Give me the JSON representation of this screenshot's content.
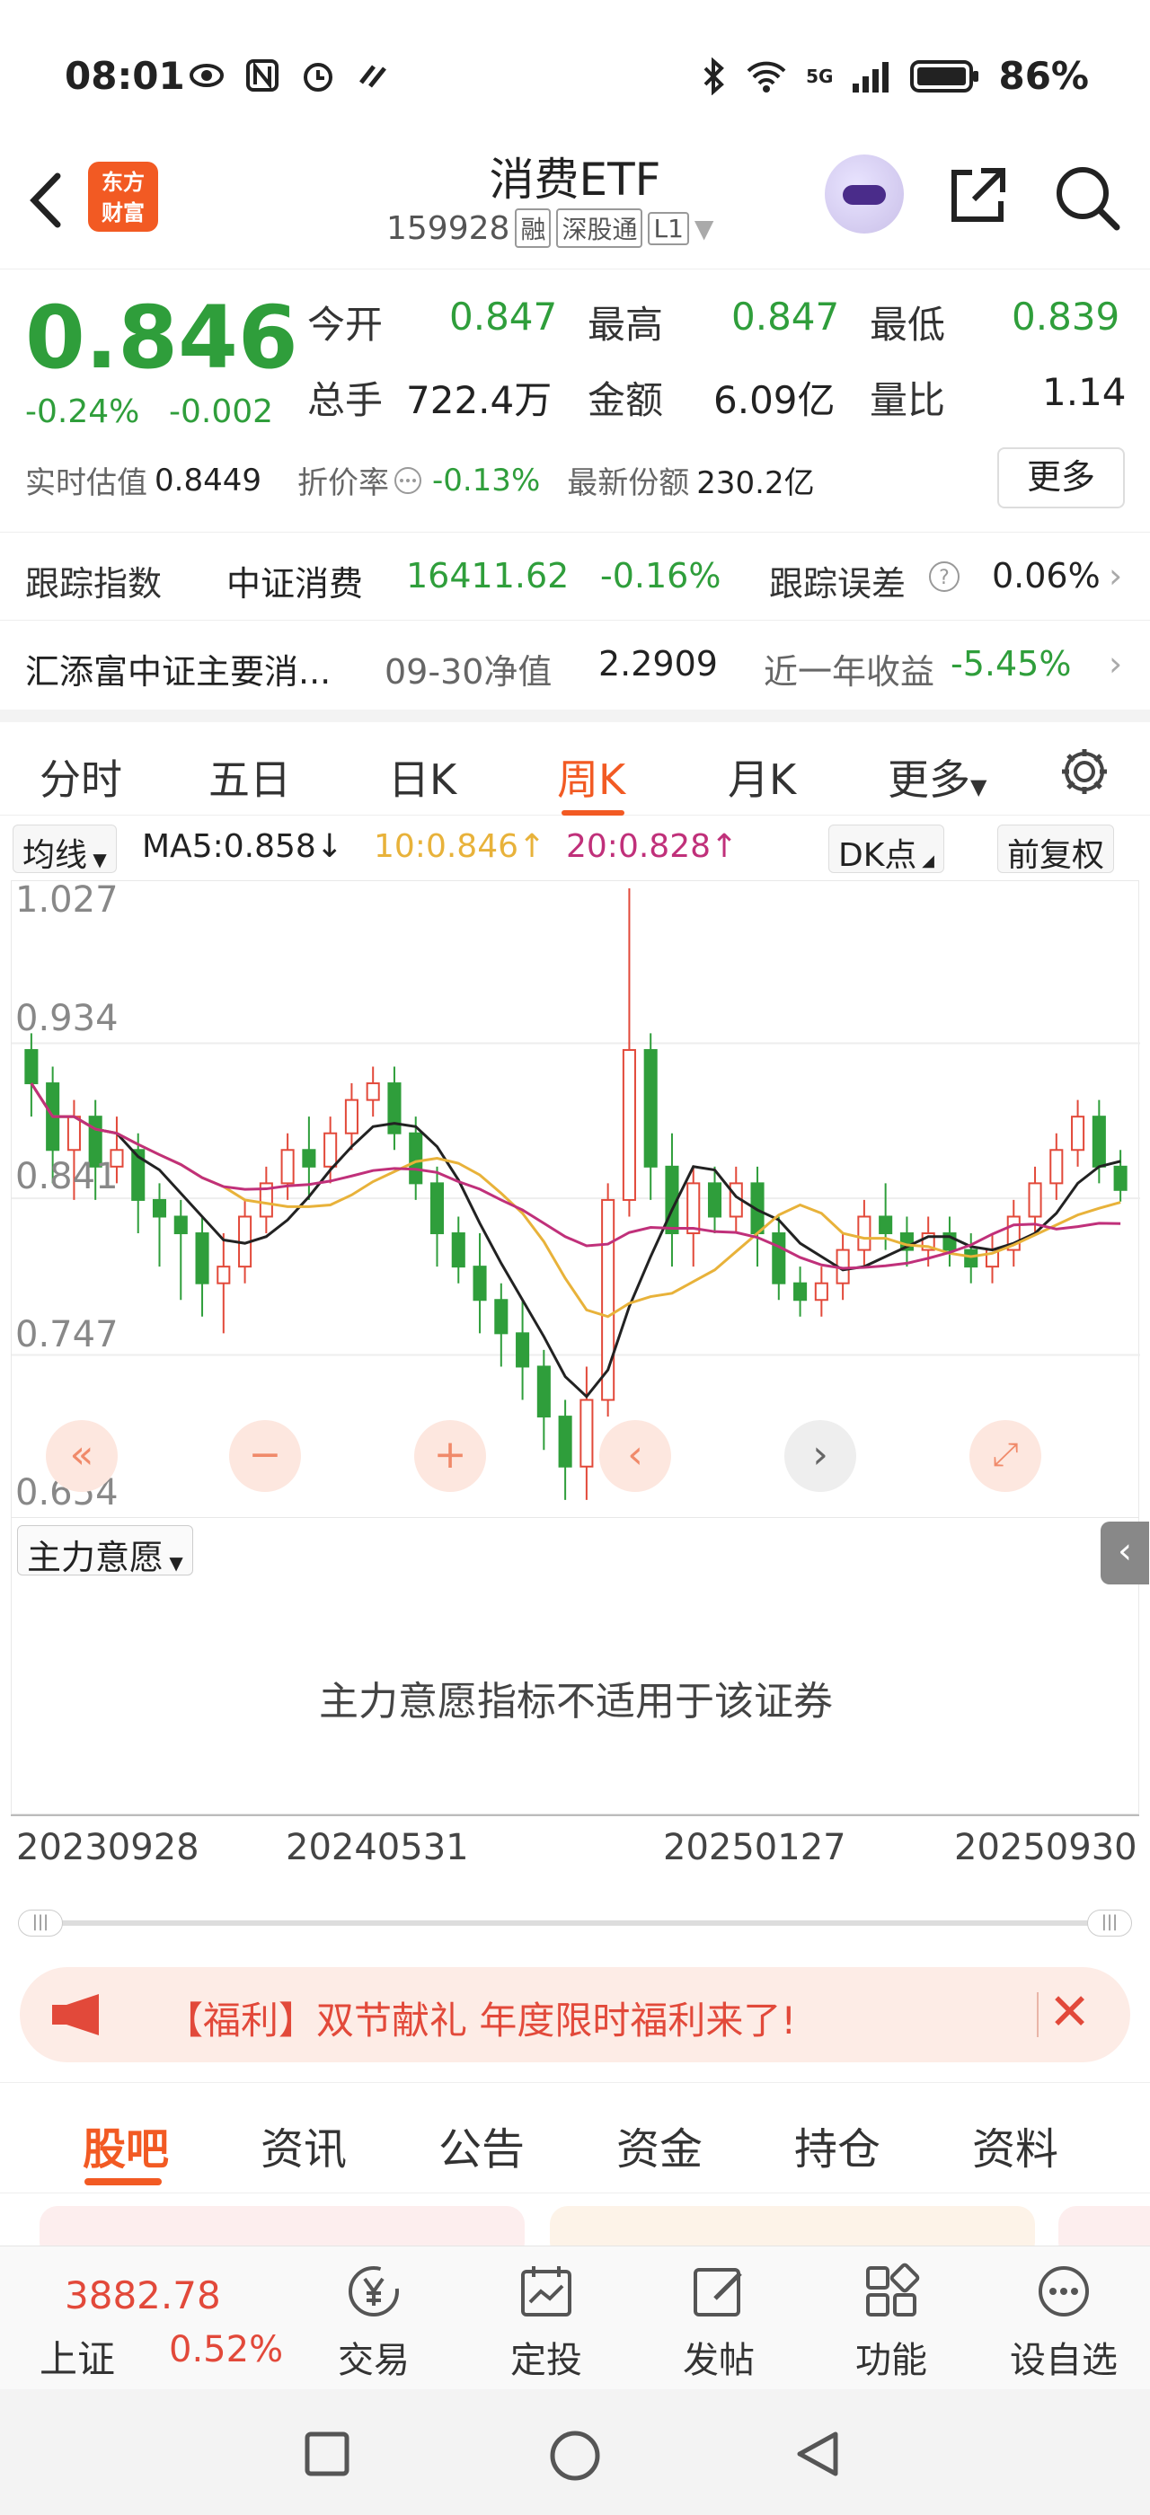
{
  "status_bar": {
    "time": "08:01",
    "network": "5G",
    "battery": "86%",
    "icons": [
      "eye-icon",
      "nfc-icon",
      "alarm-icon",
      "swipe-icon",
      "bluetooth-icon",
      "wifi-icon",
      "signal-icon",
      "battery-icon"
    ]
  },
  "header": {
    "logo_text_1": "东方",
    "logo_text_2": "财富",
    "title": "消费ETF",
    "code": "159928",
    "tags": [
      "融",
      "深股通",
      "L1"
    ]
  },
  "quote": {
    "price": "0.846",
    "change_pct": "-0.24%",
    "change_abs": "-0.002",
    "open_label": "今开",
    "open": "0.847",
    "high_label": "最高",
    "high": "0.847",
    "low_label": "最低",
    "low": "0.839",
    "volume_label": "总手",
    "volume": "722.4万",
    "amount_label": "金额",
    "amount": "6.09亿",
    "ratio_label": "量比",
    "ratio": "1.14",
    "est_label": "实时估值",
    "est_value": "0.8449",
    "premium_label": "折价率",
    "premium": "-0.13%",
    "shares_label": "最新份额",
    "shares": "230.2亿",
    "more_button": "更多"
  },
  "tracking": {
    "label": "跟踪指数",
    "index_name": "中证消费",
    "index_value": "16411.62",
    "index_change": "-0.16%",
    "error_label": "跟踪误差",
    "error_value": "0.06%"
  },
  "fund": {
    "name": "汇添富中证主要消...",
    "nav_date_label": "09-30净值",
    "nav": "2.2909",
    "return_label": "近一年收益",
    "return_value": "-5.45%"
  },
  "chart_tabs": [
    "分时",
    "五日",
    "日K",
    "周K",
    "月K",
    "更多"
  ],
  "chart_tab_active": "周K",
  "ma_row": {
    "selector": "均线",
    "ma5": "MA5:0.858",
    "ma10": "10:0.846",
    "ma20": "20:0.828",
    "dk_button": "DK点",
    "adjust_button": "前复权"
  },
  "indicator": {
    "selector": "主力意愿",
    "message": "主力意愿指标不适用于该证券"
  },
  "colors": {
    "up": "#e2493a",
    "down": "#2f9e3b",
    "accent": "#f25a23",
    "ma5": "#222222",
    "ma10": "#e8b23a",
    "ma20": "#c0307a"
  },
  "chart_data": {
    "type": "candlestick",
    "y_ticks": [
      "1.027",
      "0.934",
      "0.841",
      "0.747",
      "0.654"
    ],
    "ylim": [
      0.654,
      1.027
    ],
    "x_ticks": [
      "20230928",
      "20240531",
      "20250127",
      "20250930"
    ],
    "candles": [
      [
        0.93,
        0.91,
        0.94,
        0.89
      ],
      [
        0.91,
        0.87,
        0.92,
        0.85
      ],
      [
        0.87,
        0.89,
        0.9,
        0.84
      ],
      [
        0.89,
        0.86,
        0.9,
        0.84
      ],
      [
        0.86,
        0.87,
        0.89,
        0.85
      ],
      [
        0.87,
        0.84,
        0.88,
        0.82
      ],
      [
        0.84,
        0.83,
        0.85,
        0.8
      ],
      [
        0.83,
        0.82,
        0.84,
        0.78
      ],
      [
        0.82,
        0.79,
        0.83,
        0.77
      ],
      [
        0.79,
        0.8,
        0.82,
        0.76
      ],
      [
        0.8,
        0.83,
        0.84,
        0.79
      ],
      [
        0.83,
        0.85,
        0.86,
        0.82
      ],
      [
        0.85,
        0.87,
        0.88,
        0.84
      ],
      [
        0.87,
        0.86,
        0.89,
        0.84
      ],
      [
        0.86,
        0.88,
        0.89,
        0.85
      ],
      [
        0.88,
        0.9,
        0.91,
        0.87
      ],
      [
        0.9,
        0.91,
        0.92,
        0.89
      ],
      [
        0.91,
        0.88,
        0.92,
        0.87
      ],
      [
        0.88,
        0.85,
        0.89,
        0.84
      ],
      [
        0.85,
        0.82,
        0.86,
        0.8
      ],
      [
        0.82,
        0.8,
        0.83,
        0.79
      ],
      [
        0.8,
        0.78,
        0.82,
        0.76
      ],
      [
        0.78,
        0.76,
        0.79,
        0.74
      ],
      [
        0.76,
        0.74,
        0.78,
        0.72
      ],
      [
        0.74,
        0.71,
        0.75,
        0.69
      ],
      [
        0.71,
        0.68,
        0.72,
        0.66
      ],
      [
        0.68,
        0.72,
        0.74,
        0.66
      ],
      [
        0.72,
        0.84,
        0.85,
        0.71
      ],
      [
        0.84,
        0.93,
        1.027,
        0.83
      ],
      [
        0.93,
        0.86,
        0.94,
        0.84
      ],
      [
        0.86,
        0.82,
        0.88,
        0.8
      ],
      [
        0.82,
        0.85,
        0.86,
        0.8
      ],
      [
        0.85,
        0.83,
        0.86,
        0.82
      ],
      [
        0.83,
        0.85,
        0.86,
        0.82
      ],
      [
        0.85,
        0.82,
        0.86,
        0.8
      ],
      [
        0.82,
        0.79,
        0.83,
        0.78
      ],
      [
        0.79,
        0.78,
        0.8,
        0.77
      ],
      [
        0.78,
        0.79,
        0.8,
        0.77
      ],
      [
        0.79,
        0.81,
        0.82,
        0.78
      ],
      [
        0.81,
        0.83,
        0.84,
        0.8
      ],
      [
        0.83,
        0.82,
        0.85,
        0.81
      ],
      [
        0.82,
        0.81,
        0.83,
        0.8
      ],
      [
        0.81,
        0.82,
        0.83,
        0.8
      ],
      [
        0.82,
        0.81,
        0.83,
        0.8
      ],
      [
        0.81,
        0.8,
        0.82,
        0.79
      ],
      [
        0.8,
        0.81,
        0.82,
        0.79
      ],
      [
        0.81,
        0.83,
        0.84,
        0.8
      ],
      [
        0.83,
        0.85,
        0.86,
        0.82
      ],
      [
        0.85,
        0.87,
        0.88,
        0.84
      ],
      [
        0.87,
        0.89,
        0.9,
        0.86
      ],
      [
        0.89,
        0.86,
        0.9,
        0.85
      ],
      [
        0.86,
        0.846,
        0.87,
        0.839
      ]
    ]
  },
  "banner": {
    "text": "【福利】双节献礼 年度限时福利来了!"
  },
  "news_tabs": [
    "股吧",
    "资讯",
    "公告",
    "资金",
    "持仓",
    "资料"
  ],
  "news_tab_active": "股吧",
  "bottom": {
    "index_value": "3882.78",
    "index_name": "上证",
    "index_change": "0.52%",
    "items": [
      "交易",
      "定投",
      "发帖",
      "功能",
      "设自选"
    ]
  }
}
